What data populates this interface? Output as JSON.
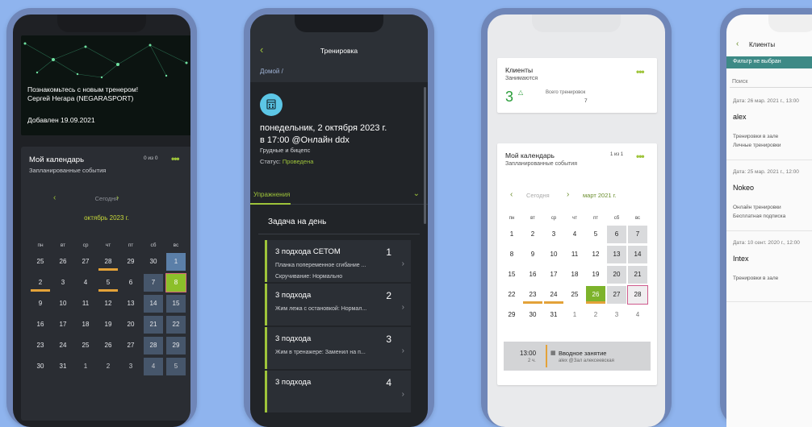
{
  "phone1": {
    "news_line1": "Познакомьтесь с новым тренером!",
    "news_line2": "Сергей Негара (NEGARASPORT)",
    "news_date": "Добавлен 19.09.2021",
    "calendar_title": "Мой календарь",
    "calendar_sub": "Запланированные события",
    "count": "0 из 0",
    "today": "Сегодня",
    "month": "октябрь 2023 г.",
    "dow": [
      "пн",
      "вт",
      "ср",
      "чт",
      "пт",
      "сб",
      "вс"
    ],
    "weeks": [
      [
        "25",
        "26",
        "27",
        "28",
        "29",
        "30",
        "1"
      ],
      [
        "2",
        "3",
        "4",
        "5",
        "6",
        "7",
        "8"
      ],
      [
        "9",
        "10",
        "11",
        "12",
        "13",
        "14",
        "15"
      ],
      [
        "16",
        "17",
        "18",
        "19",
        "20",
        "21",
        "22"
      ],
      [
        "23",
        "24",
        "25",
        "26",
        "27",
        "28",
        "29"
      ],
      [
        "30",
        "31",
        "1",
        "2",
        "3",
        "4",
        "5"
      ]
    ]
  },
  "phone2": {
    "title": "Тренировка",
    "crumb": "Домой /",
    "date_line1": "понедельник, 2 октября 2023 г.",
    "date_line2": "в 17:00 @Онлайн ddx",
    "muscles": "Грудные и бицепс",
    "status_label": "Статус:",
    "status_value": "Проведена",
    "tab": "Упражнения",
    "task": "Задача на день",
    "exercises": [
      {
        "title": "3 подхода СЕТОМ",
        "num": "1",
        "d1": "Планка попеременное сгибание ...",
        "d2": "Скручивание: Нормально"
      },
      {
        "title": "3 подхода",
        "num": "2",
        "d1": "Жим лежа с остановкой: Нормал...",
        "d2": ""
      },
      {
        "title": "3 подхода",
        "num": "3",
        "d1": "Жим в тренажере: Заменил на п...",
        "d2": ""
      },
      {
        "title": "3 подхода",
        "num": "4",
        "d1": "",
        "d2": ""
      }
    ]
  },
  "phone3": {
    "clients_title": "Клиенты",
    "clients_sub": "Занимаются",
    "clients_count": "3",
    "total_label": "Всего тренировок",
    "total_value": "7",
    "calendar_title": "Мой календарь",
    "calendar_sub": "Запланированные события",
    "count": "1 из 1",
    "today": "Сегодня",
    "month": "март 2021 г.",
    "dow": [
      "пн",
      "вт",
      "ср",
      "чт",
      "пт",
      "сб",
      "вс"
    ],
    "weeks": [
      [
        "1",
        "2",
        "3",
        "4",
        "5",
        "6",
        "7"
      ],
      [
        "8",
        "9",
        "10",
        "11",
        "12",
        "13",
        "14"
      ],
      [
        "15",
        "16",
        "17",
        "18",
        "19",
        "20",
        "21"
      ],
      [
        "22",
        "23",
        "24",
        "25",
        "26",
        "27",
        "28"
      ],
      [
        "29",
        "30",
        "31",
        "1",
        "2",
        "3",
        "4"
      ]
    ],
    "event_time": "13:00",
    "event_duration": "2 ч.",
    "event_title": "Вводное занятие",
    "event_location": "alex @Зал алексеевская"
  },
  "phone4": {
    "title": "Клиенты",
    "filter": "Фильтр не выбран",
    "search_placeholder": "Поиск",
    "items": [
      {
        "date": "Дата: 26 мар. 2021 г., 13:00",
        "name": "alex",
        "l1": "Тренировки в зале",
        "l2": "Личные тренировки"
      },
      {
        "date": "Дата: 25 мар. 2021 г., 12:00",
        "name": "Nokeo",
        "l1": "Онлайн тренировки",
        "l2": "Бесплатная подписка"
      },
      {
        "date": "Дата: 10 сент. 2020 г., 12:00",
        "name": "Intex",
        "l1": "Тренировки в зале",
        "l2": ""
      }
    ]
  },
  "colors": {
    "accent": "#9ec43a",
    "background": "#8fb4ee",
    "frame": "#6f86b8"
  }
}
